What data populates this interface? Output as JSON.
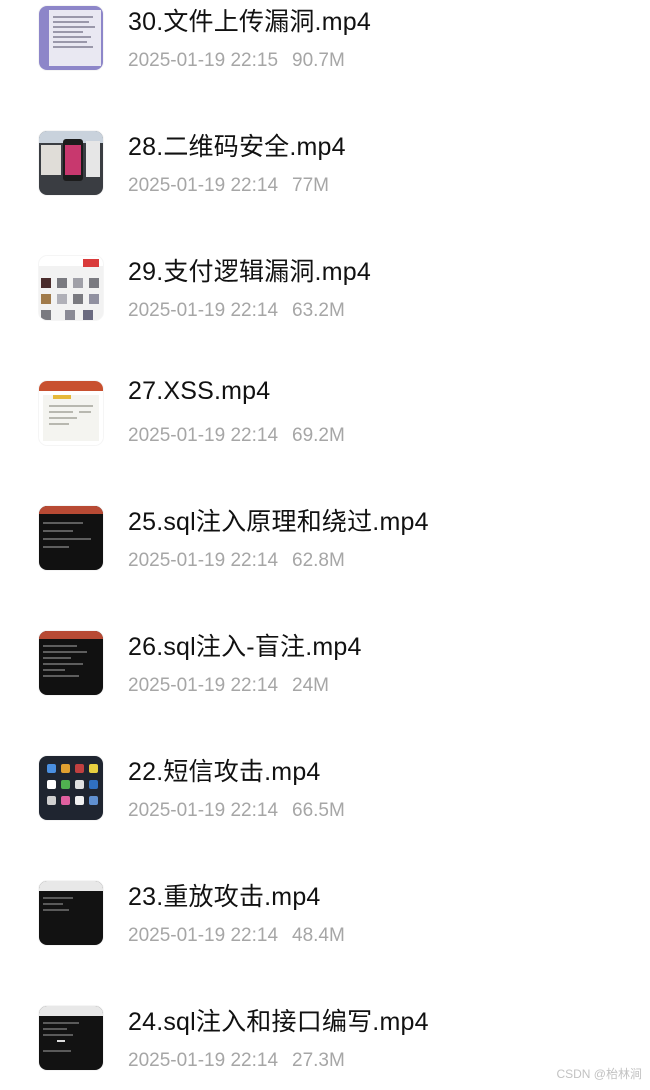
{
  "files": [
    {
      "name": "30.文件上传漏洞.mp4",
      "date": "2025-01-19 22:15",
      "size": "90.7M",
      "thumbnail": "document-thumbnail"
    },
    {
      "name": "28.二维码安全.mp4",
      "date": "2025-01-19 22:14",
      "size": "77M",
      "thumbnail": "qr-code-thumbnail"
    },
    {
      "name": "29.支付逻辑漏洞.mp4",
      "date": "2025-01-19 22:14",
      "size": "63.2M",
      "thumbnail": "shop-page-thumbnail"
    },
    {
      "name": "27.XSS.mp4",
      "date": "2025-01-19 22:14",
      "size": "69.2M",
      "thumbnail": "slide-thumbnail"
    },
    {
      "name": "25.sql注入原理和绕过.mp4",
      "date": "2025-01-19 22:14",
      "size": "62.8M",
      "thumbnail": "terminal-thumbnail"
    },
    {
      "name": "26.sql注入-盲注.mp4",
      "date": "2025-01-19 22:14",
      "size": "24M",
      "thumbnail": "terminal-thumbnail"
    },
    {
      "name": "22.短信攻击.mp4",
      "date": "2025-01-19 22:14",
      "size": "66.5M",
      "thumbnail": "phone-home-screen-thumbnail"
    },
    {
      "name": "23.重放攻击.mp4",
      "date": "2025-01-19 22:14",
      "size": "48.4M",
      "thumbnail": "terminal-thumbnail"
    },
    {
      "name": "24.sql注入和接口编写.mp4",
      "date": "2025-01-19 22:14",
      "size": "27.3M",
      "thumbnail": "terminal-thumbnail"
    }
  ],
  "watermark": "CSDN @枱林涧"
}
